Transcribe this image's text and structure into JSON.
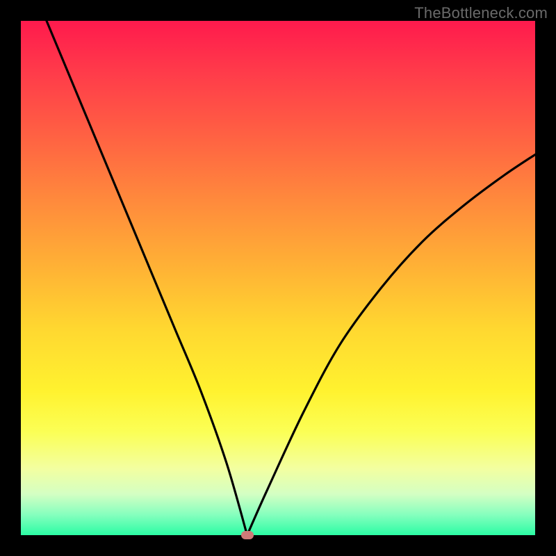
{
  "watermark": "TheBottleneck.com",
  "colors": {
    "frame": "#000000",
    "marker": "#cf7a78",
    "curve": "#000000"
  },
  "chart_data": {
    "type": "line",
    "title": "",
    "xlabel": "",
    "ylabel": "",
    "xlim": [
      0,
      100
    ],
    "ylim": [
      0,
      100
    ],
    "grid": false,
    "legend": false,
    "annotations": [
      {
        "label": "vertex-marker",
        "x": 44,
        "y": 0
      }
    ],
    "series": [
      {
        "name": "bottleneck-curve",
        "x": [
          5,
          10,
          15,
          20,
          25,
          30,
          35,
          40,
          44,
          48,
          55,
          62,
          70,
          78,
          86,
          94,
          100
        ],
        "y": [
          100,
          88,
          76,
          64,
          52,
          40,
          28,
          14,
          0,
          9,
          24,
          37,
          48,
          57,
          64,
          70,
          74
        ]
      }
    ]
  }
}
